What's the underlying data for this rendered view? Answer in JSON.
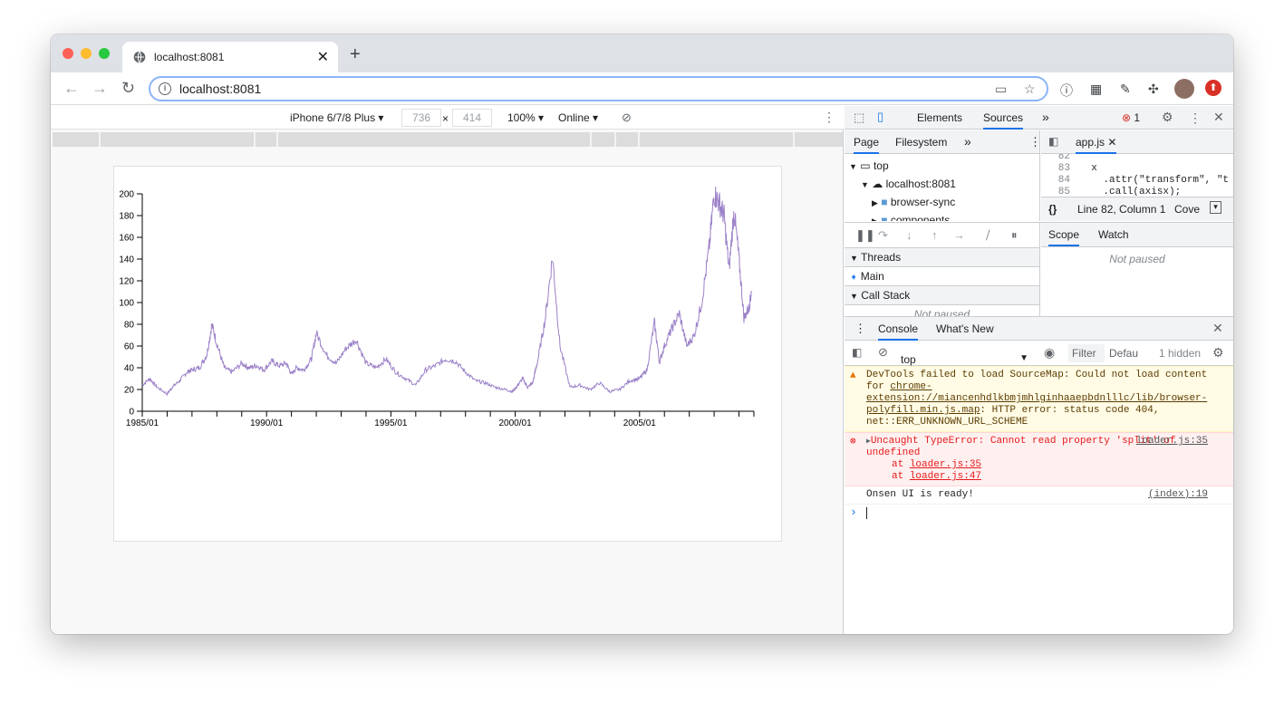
{
  "browser": {
    "tab_title": "localhost:8081",
    "url": "localhost:8081",
    "new_tab": "+",
    "tab_close": "✕"
  },
  "device_toolbar": {
    "device": "iPhone 6/7/8 Plus",
    "width": "736",
    "times": "×",
    "height": "414",
    "zoom": "100%",
    "network": "Online"
  },
  "chart_data": {
    "type": "line",
    "color": "#9b80c8",
    "x_tick_labels": [
      "1985/01",
      "1990/01",
      "1995/01",
      "2000/01",
      "2005/01"
    ],
    "y_ticks": [
      0,
      20,
      40,
      60,
      80,
      100,
      120,
      140,
      160,
      180,
      200
    ],
    "ylim": [
      0,
      200
    ],
    "xlim": [
      1985.0,
      2009.6
    ],
    "series": [
      {
        "x": [
          1985.0,
          1985.3,
          1985.6,
          1986.0,
          1986.2,
          1986.5,
          1986.8,
          1987.0,
          1987.3,
          1987.6,
          1987.8,
          1988.0,
          1988.3,
          1988.6,
          1989.0,
          1989.3,
          1989.6,
          1989.9,
          1990.2,
          1990.5,
          1990.8,
          1991.0,
          1991.2,
          1991.5,
          1991.8,
          1992.0,
          1992.4,
          1992.8,
          1993.2,
          1993.6,
          1994.0,
          1994.4,
          1994.8,
          1995.2,
          1995.6,
          1996.0,
          1996.4,
          1996.8,
          1997.2,
          1997.6,
          1998.0,
          1998.4,
          1998.8,
          1999.2,
          1999.6,
          1999.9,
          2000.1,
          2000.3,
          2000.5,
          2000.7,
          2000.9,
          2001.2,
          2001.5,
          2001.8,
          2002.2,
          2002.6,
          2003.0,
          2003.4,
          2003.8,
          2004.2,
          2004.6,
          2005.0,
          2005.3,
          2005.6,
          2005.8,
          2006.0,
          2006.3,
          2006.6,
          2006.9,
          2007.2,
          2007.5,
          2007.8,
          2008.0,
          2008.2,
          2008.4,
          2008.6,
          2008.8,
          2009.0,
          2009.2,
          2009.4,
          2009.5
        ],
        "y": [
          24,
          30,
          22,
          16,
          22,
          28,
          36,
          38,
          40,
          52,
          80,
          62,
          40,
          36,
          44,
          40,
          42,
          38,
          46,
          42,
          44,
          34,
          40,
          38,
          48,
          72,
          52,
          44,
          58,
          66,
          44,
          40,
          48,
          36,
          30,
          24,
          38,
          42,
          48,
          46,
          36,
          28,
          26,
          22,
          20,
          18,
          24,
          30,
          22,
          26,
          46,
          84,
          142,
          60,
          22,
          24,
          20,
          26,
          18,
          20,
          28,
          30,
          38,
          82,
          45,
          60,
          76,
          90,
          60,
          70,
          100,
          150,
          200,
          192,
          180,
          130,
          185,
          140,
          86,
          95,
          110
        ]
      }
    ]
  },
  "devtools": {
    "tabs": [
      "Elements",
      "Sources"
    ],
    "more": "»",
    "error_count": "1",
    "sources_nav": [
      "Page",
      "Filesystem"
    ],
    "tree": [
      "top",
      "localhost:8081",
      "browser-sync",
      "components"
    ],
    "editor_tab": "app.js",
    "code_lines": [
      {
        "n": "82",
        "t": ""
      },
      {
        "n": "83",
        "t": "  x"
      },
      {
        "n": "84",
        "t": "    .attr(\"transform\", \"t"
      },
      {
        "n": "85",
        "t": "    .call(axisx);"
      }
    ],
    "status": "Line 82, Column 1",
    "coverage": "Cove",
    "threads_label": "Threads",
    "main_thread": "Main",
    "callstack_label": "Call Stack",
    "not_paused": "Not paused",
    "scope_tabs": [
      "Scope",
      "Watch"
    ],
    "scope_not_paused": "Not paused"
  },
  "console": {
    "tabs": [
      "Console",
      "What's New"
    ],
    "context": "top",
    "filter_placeholder": "Filter",
    "levels": "Defau",
    "hidden": "1 hidden",
    "warn_pre": "DevTools failed to load SourceMap: Could not load content for ",
    "warn_link": "chrome-extension://miancenhdlkbmjmhlginhaaepbdnlllc/lib/browser-polyfill.min.js.map",
    "warn_post": ": HTTP error: status code 404, net::ERR_UNKNOWN_URL_SCHEME",
    "err_text": "Uncaught TypeError: Cannot read property 'split' of undefined",
    "err_src": "loader.js:35",
    "err_at1": "loader.js:35",
    "err_at2": "loader.js:47",
    "at_word": "at",
    "info_text": "Onsen UI is ready!",
    "info_src": "(index):19",
    "prompt": "›"
  }
}
